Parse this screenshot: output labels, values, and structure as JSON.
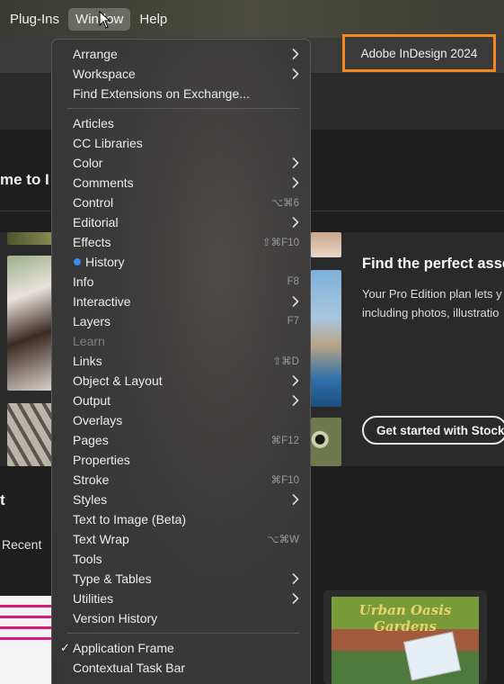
{
  "menubar": {
    "items": [
      {
        "label": "Plug-Ins",
        "active": false
      },
      {
        "label": "Window",
        "active": true
      },
      {
        "label": "Help",
        "active": false
      }
    ]
  },
  "app": {
    "title": "Adobe InDesign 2024",
    "welcome_partial": "me to I",
    "section_partial": "t",
    "recent_label": "Recent",
    "stock": {
      "title": "Find the perfect asse",
      "line1": "Your Pro Edition plan lets y",
      "line2": "including photos, illustratio",
      "button": "Get started with Stock"
    },
    "doc_thumb_title": "Urban Oasis Gardens"
  },
  "menu": {
    "items": [
      {
        "label": "Arrange",
        "submenu": true
      },
      {
        "label": "Workspace",
        "submenu": true
      },
      {
        "label": "Find Extensions on Exchange..."
      },
      {
        "separator": true
      },
      {
        "label": "Articles"
      },
      {
        "label": "CC Libraries"
      },
      {
        "label": "Color",
        "submenu": true
      },
      {
        "label": "Comments",
        "submenu": true
      },
      {
        "label": "Control",
        "shortcut": "⌥⌘6"
      },
      {
        "label": "Editorial",
        "submenu": true
      },
      {
        "label": "Effects",
        "shortcut": "⇧⌘F10"
      },
      {
        "label": "History",
        "dot": true
      },
      {
        "label": "Info",
        "shortcut": "F8"
      },
      {
        "label": "Interactive",
        "submenu": true
      },
      {
        "label": "Layers",
        "shortcut": "F7"
      },
      {
        "label": "Learn",
        "disabled": true
      },
      {
        "label": "Links",
        "shortcut": "⇧⌘D"
      },
      {
        "label": "Object & Layout",
        "submenu": true
      },
      {
        "label": "Output",
        "submenu": true
      },
      {
        "label": "Overlays"
      },
      {
        "label": "Pages",
        "shortcut": "⌘F12"
      },
      {
        "label": "Properties"
      },
      {
        "label": "Stroke",
        "shortcut": "⌘F10"
      },
      {
        "label": "Styles",
        "submenu": true
      },
      {
        "label": "Text to Image (Beta)"
      },
      {
        "label": "Text Wrap",
        "shortcut": "⌥⌘W"
      },
      {
        "label": "Tools"
      },
      {
        "label": "Type & Tables",
        "submenu": true
      },
      {
        "label": "Utilities",
        "submenu": true
      },
      {
        "label": "Version History"
      },
      {
        "separator": true
      },
      {
        "label": "Application Frame",
        "checked": true
      },
      {
        "label": "Contextual Task Bar"
      }
    ]
  },
  "colors": {
    "highlight_border": "#f08a1c",
    "history_dot": "#3a8ee6"
  }
}
